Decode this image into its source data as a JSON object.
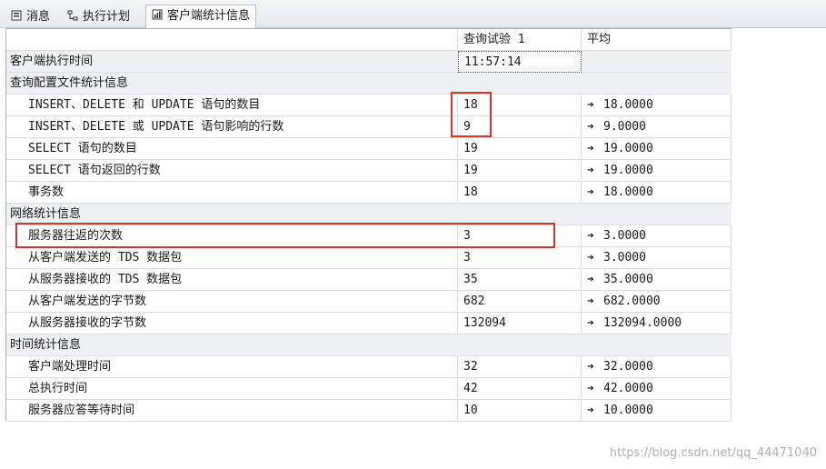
{
  "tabs": [
    {
      "label": "消息",
      "icon": "messages-icon"
    },
    {
      "label": "执行计划",
      "icon": "execution-plan-icon"
    },
    {
      "label": "客户端统计信息",
      "icon": "client-statistics-icon",
      "active": true
    }
  ],
  "columns": [
    "",
    "查询试验 1",
    "平均"
  ],
  "arrow_glyph": "➔",
  "rows": [
    {
      "type": "section",
      "label": "客户端执行时间",
      "value": "11:57:14",
      "avg": ""
    },
    {
      "type": "section",
      "label": "查询配置文件统计信息",
      "value": "",
      "avg": ""
    },
    {
      "type": "item",
      "label": "INSERT、DELETE 和 UPDATE 语句的数目",
      "value": "18",
      "avg": "18.0000"
    },
    {
      "type": "item",
      "label": "INSERT、DELETE 或 UPDATE 语句影响的行数",
      "value": "9",
      "avg": "9.0000"
    },
    {
      "type": "item",
      "label": "SELECT 语句的数目",
      "value": "19",
      "avg": "19.0000"
    },
    {
      "type": "item",
      "label": "SELECT 语句返回的行数",
      "value": "19",
      "avg": "19.0000"
    },
    {
      "type": "item",
      "label": "事务数",
      "value": "18",
      "avg": "18.0000"
    },
    {
      "type": "section",
      "label": "网络统计信息",
      "value": "",
      "avg": ""
    },
    {
      "type": "item",
      "label": "服务器往返的次数",
      "value": "3",
      "avg": "3.0000"
    },
    {
      "type": "item",
      "label": "从客户端发送的 TDS 数据包",
      "value": "3",
      "avg": "3.0000"
    },
    {
      "type": "item",
      "label": "从服务器接收的 TDS 数据包",
      "value": "35",
      "avg": "35.0000"
    },
    {
      "type": "item",
      "label": "从客户端发送的字节数",
      "value": "682",
      "avg": "682.0000"
    },
    {
      "type": "item",
      "label": "从服务器接收的字节数",
      "value": "132094",
      "avg": "132094.0000"
    },
    {
      "type": "section",
      "label": "时间统计信息",
      "value": "",
      "avg": ""
    },
    {
      "type": "item",
      "label": "客户端处理时间",
      "value": "32",
      "avg": "32.0000"
    },
    {
      "type": "item",
      "label": "总执行时间",
      "value": "42",
      "avg": "42.0000"
    },
    {
      "type": "item",
      "label": "服务器应答等待时间",
      "value": "10",
      "avg": "10.0000"
    }
  ],
  "watermark": "https://blog.csdn.net/qq_44471040",
  "colors": {
    "highlight": "#e03030",
    "section_bg": "#eef0f3"
  }
}
